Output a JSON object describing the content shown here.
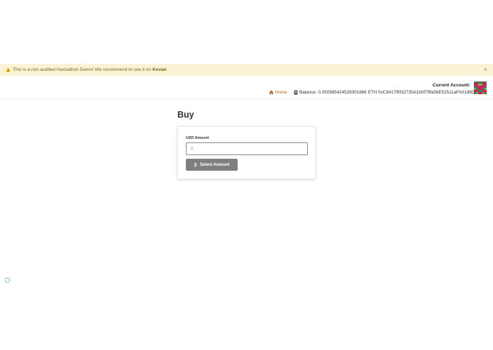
{
  "banner": {
    "text": "This is a non audited Hackathon Demo! We recommend to use it on",
    "network": "Kovan",
    "close_symbol": "×",
    "warning_color": "#f0b400"
  },
  "header": {
    "home_label": "Home",
    "balance_prefix": "Balance: ",
    "balance_value": "0.050985424528301886",
    "balance_unit": "ETH",
    "account_title": "Current Account:",
    "account_address": "0xC9417f8f32735A1b0f79fa56E52511aFA01d8Ca1",
    "accent_color": "#b5651d"
  },
  "main": {
    "title": "Buy",
    "usd_label": "USD Amount",
    "usd_placeholder": "0",
    "select_button_icon": "$",
    "select_button_label": "Select Amount"
  }
}
